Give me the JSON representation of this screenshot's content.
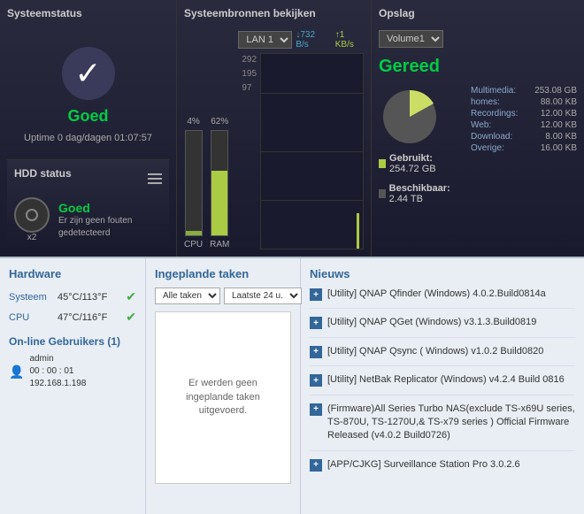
{
  "top": {
    "systeemstatus": {
      "title": "Systeemstatus",
      "status": "Goed",
      "uptime": "Uptime 0 dag/dagen 01:07:57"
    },
    "hdd": {
      "title": "HDD status",
      "status": "Goed",
      "x2": "x2",
      "desc_line1": "Er zijn geen fouten",
      "desc_line2": "gedetecteerd"
    },
    "bronnen": {
      "title": "Systeembronnen bekijken",
      "cpu_pct": "4%",
      "ram_pct": "62%",
      "cpu_label": "CPU",
      "ram_label": "RAM",
      "lan_label": "LAN 1",
      "down_speed": "↓732 B/s",
      "up_speed": "↑1 KB/s",
      "grid_values": [
        "292",
        "195",
        "97"
      ]
    },
    "opslag": {
      "title": "Opslag",
      "volume": "Volume1",
      "status": "Gereed",
      "used_label": "Gebruikt:",
      "used_value": "254.72 GB",
      "free_label": "Beschikbaar:",
      "free_value": "2.44 TB",
      "details": [
        {
          "label": "Multimedia:",
          "value": "253.08 GB"
        },
        {
          "label": "homes:",
          "value": "88.00 KB"
        },
        {
          "label": "Recordings:",
          "value": "12.00 KB"
        },
        {
          "label": "Web:",
          "value": "12.00 KB"
        },
        {
          "label": "Download:",
          "value": "8.00 KB"
        },
        {
          "label": "Overige:",
          "value": "16.00 KB"
        }
      ]
    }
  },
  "bottom": {
    "hardware": {
      "title": "Hardware",
      "systeem_label": "Systeem",
      "systeem_value": "45°C/113°F",
      "cpu_label": "CPU",
      "cpu_value": "47°C/116°F"
    },
    "online": {
      "title": "On-line Gebruikers (1)",
      "user": "admin",
      "time": "00 : 00 : 01",
      "ip": "192.168.1.198"
    },
    "taken": {
      "title": "Ingeplande taken",
      "filter1": "Alle taken",
      "filter2": "Laatste 24 u.",
      "empty_text": "Er werden geen ingeplande taken uitgevoerd."
    },
    "nieuws": {
      "title": "Nieuws",
      "items": [
        "[Utility] QNAP Qfinder (Windows) 4.0.2.Build0814a",
        "[Utility] QNAP QGet (Windows) v3.1.3.Build0819",
        "[Utility] QNAP Qsync ( Windows) v1.0.2 Build0820",
        "[Utility] NetBak Replicator (Windows) v4.2.4 Build 0816",
        "(Firmware)All Series Turbo NAS(exclude TS-x69U series, TS-870U, TS-1270U,& TS-x79 series ) Official Firmware Released (v4.0.2 Build0726)",
        "[APP/CJKG] Surveillance Station Pro 3.0.2.6"
      ]
    }
  }
}
